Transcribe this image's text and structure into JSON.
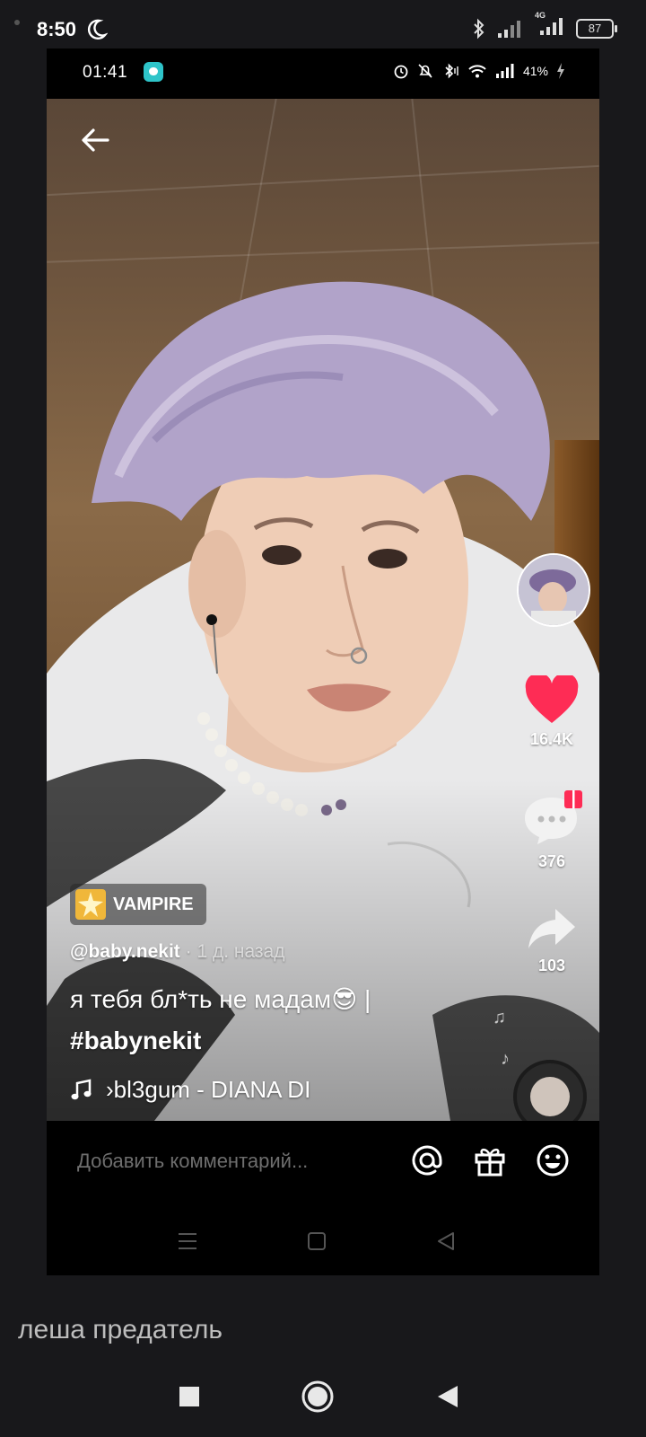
{
  "outer_status": {
    "time": "8:50",
    "battery": "87",
    "network": "4G"
  },
  "inner_status": {
    "time": "01:41",
    "battery_percent": "41%"
  },
  "video": {
    "tag": "VAMPIRE",
    "author": "@baby.nekit",
    "posted": " · 1 д. назад",
    "caption_line1": "я тебя бл*ть не мадам😎 |",
    "caption_line2": "#babynekit",
    "music": "›bl3gum - DIANA DI"
  },
  "actions": {
    "likes": "16.4K",
    "comments": "376",
    "shares": "103"
  },
  "comment_bar": {
    "placeholder": "Добавить комментарий..."
  },
  "below_caption": "леша предатель",
  "colors": {
    "like": "#fe2c55",
    "comment_icon": "#ffffff",
    "gift": "#fe2c55"
  }
}
